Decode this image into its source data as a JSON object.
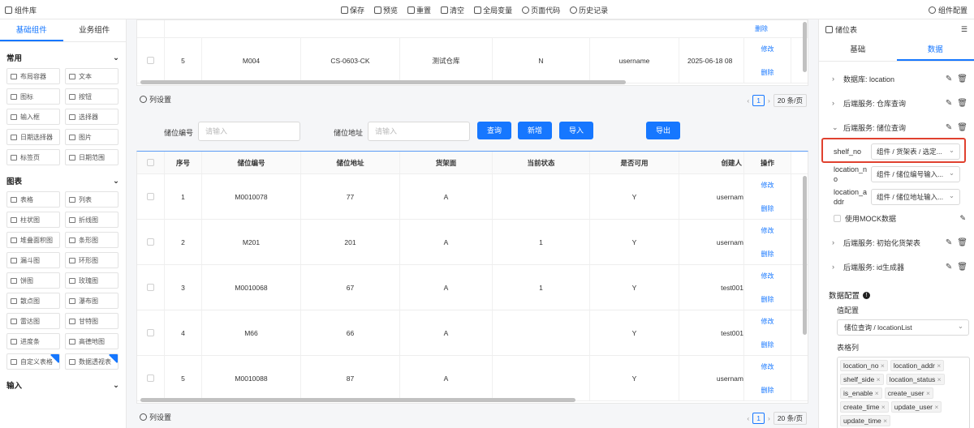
{
  "topbar": {
    "library": "组件库",
    "tools": [
      "保存",
      "预览",
      "重置",
      "清空",
      "全局变量",
      "页面代码",
      "历史记录"
    ],
    "config": "组件配置"
  },
  "left": {
    "tabs": [
      "基础组件",
      "业务组件"
    ],
    "groups": [
      {
        "title": "常用",
        "items": [
          "布局容器",
          "文本",
          "图标",
          "按钮",
          "输入框",
          "选择器",
          "日期选择器",
          "图片",
          "标签页",
          "日期范围"
        ]
      },
      {
        "title": "图表",
        "items": [
          "表格",
          "列表",
          "柱状图",
          "折线图",
          "堆叠面积图",
          "条形图",
          "漏斗图",
          "环形图",
          "饼图",
          "玫瑰图",
          "散点图",
          "瀑布图",
          "雷达图",
          "甘特图",
          "进度条",
          "高德地图",
          "自定义表格",
          "数据透视表"
        ]
      },
      {
        "title": "输入",
        "items": []
      }
    ]
  },
  "top_table": {
    "row": {
      "no": "5",
      "code": "M004",
      "addr": "CS-0603-CK",
      "wh": "测试仓库",
      "flag": "N",
      "user": "username",
      "date": "2025-06-18 08"
    },
    "ops": [
      "删除",
      "修改",
      "删除"
    ]
  },
  "colset_label": "列设置",
  "pager": {
    "page": "1",
    "size": "20 条/页"
  },
  "search": {
    "code_label": "储位编号",
    "code_placeholder": "请输入",
    "addr_label": "储位地址",
    "addr_placeholder": "请输入",
    "buttons": [
      "查询",
      "新增",
      "导入",
      "导出"
    ]
  },
  "main_table": {
    "headers": [
      "序号",
      "储位编号",
      "储位地址",
      "货架面",
      "当前状态",
      "是否可用",
      "创建人",
      "操作"
    ],
    "rows": [
      [
        "1",
        "M0010078",
        "77",
        "A",
        "",
        "Y",
        "usernam"
      ],
      [
        "2",
        "M201",
        "201",
        "A",
        "1",
        "Y",
        "usernam"
      ],
      [
        "3",
        "M0010068",
        "67",
        "A",
        "1",
        "Y",
        "test001"
      ],
      [
        "4",
        "M66",
        "66",
        "A",
        "",
        "Y",
        "test001"
      ],
      [
        "5",
        "M0010088",
        "87",
        "A",
        "",
        "Y",
        "usernam"
      ]
    ],
    "op_edit": "修改",
    "op_delete": "删除"
  },
  "right": {
    "title": "储位表",
    "tabs": [
      "基础",
      "数据"
    ],
    "datasources": [
      "数据库: location",
      "后端服务: 仓库查询",
      "后端服务: 储位查询"
    ],
    "params": [
      {
        "label": "shelf_no",
        "value": "组件 / 货架表 / 选定..."
      },
      {
        "label": "location_no",
        "value": "组件 / 储位编号输入..."
      },
      {
        "label": "location_addr",
        "value": "组件 / 储位地址输入..."
      }
    ],
    "mock": "使用MOCK数据",
    "more_sources": [
      "后端服务: 初始化货架表",
      "后端服务: id生成器"
    ],
    "config_title": "数据配置",
    "value_label": "值配置",
    "value": "储位查询 / locationList",
    "cols_label": "表格列",
    "cols": [
      "location_no",
      "location_addr",
      "shelf_side",
      "location_status",
      "is_enable",
      "create_user",
      "create_time",
      "update_user",
      "update_time"
    ]
  }
}
